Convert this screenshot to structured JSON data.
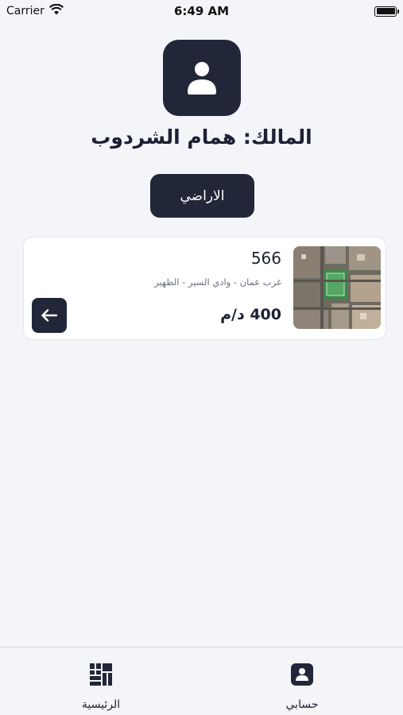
{
  "status_bar": {
    "carrier": "Carrier",
    "time": "6:49 AM"
  },
  "profile": {
    "owner_title": "المالك: همام الشردوب",
    "lands_button_label": "الاراضي"
  },
  "lands": [
    {
      "number": "566",
      "location": "غرب عمان - وادي السير - الظهير",
      "price": "400 د/م"
    }
  ],
  "tab_bar": {
    "items": [
      {
        "label": "الرئيسية",
        "icon": "grid-icon"
      },
      {
        "label": "حسابي",
        "icon": "account-icon"
      }
    ]
  },
  "colors": {
    "accent": "#222639",
    "background": "#f3f5f9",
    "card": "#ffffff"
  }
}
